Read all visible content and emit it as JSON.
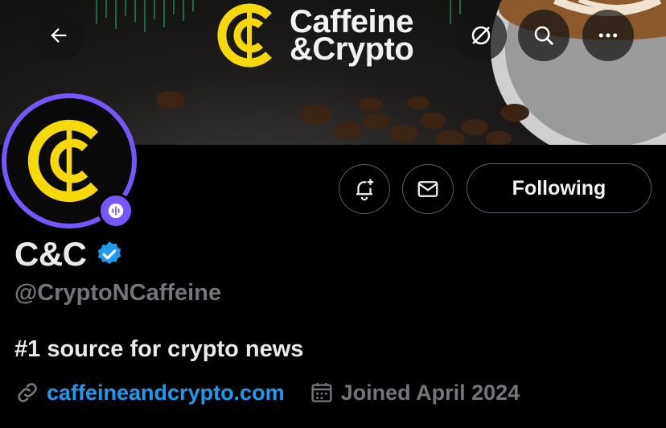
{
  "banner": {
    "brand_line1": "Caffeine",
    "brand_line2": "&Crypto",
    "back_icon": "arrow-left-icon",
    "grok_icon": "slash-circle-icon",
    "search_icon": "search-icon",
    "more_icon": "more-horizontal-icon"
  },
  "profile": {
    "name": "C&C",
    "handle": "@CryptoNCaffeine",
    "bio": "#1 source for crypto news",
    "website": "caffeineandcrypto.com",
    "joined": "Joined April 2024"
  },
  "actions": {
    "notify_icon": "bell-plus-icon",
    "message_icon": "mail-icon",
    "follow_label": "Following"
  },
  "colors": {
    "accent": "#1d9bf0",
    "avatar_ring": "#7856ff",
    "brand_yellow": "#f5d90a",
    "muted": "#71767b"
  }
}
